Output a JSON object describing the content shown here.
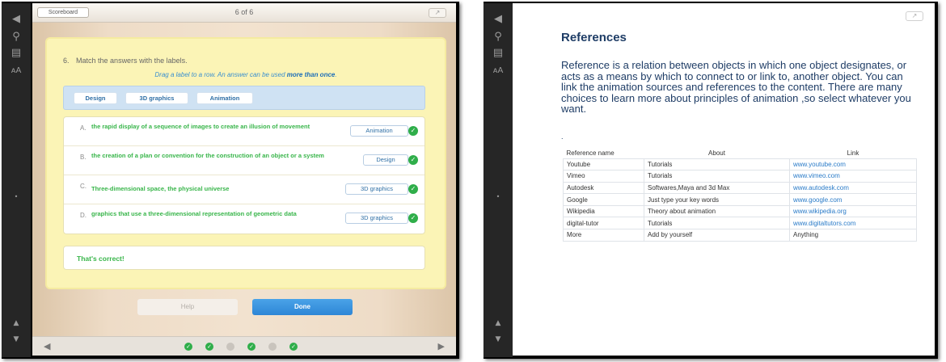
{
  "left_screen": {
    "toolbar": {
      "back_icon": "back-arrow-icon",
      "search_icon": "search-icon",
      "notes_icon": "notes-icon",
      "font_label": "ᴀA"
    },
    "top_bar": {
      "scoreboard_label": "Scoreboard",
      "page_indicator": "6 of 6"
    },
    "quiz": {
      "question_number": "6.",
      "question_text": "Match the answers with the labels.",
      "instruction_prefix": "Drag a label to a row. An answer can be used",
      "instruction_emphasis": "more than once",
      "instruction_suffix": ".",
      "labels": [
        "Design",
        "3D graphics",
        "Animation"
      ],
      "rows": [
        {
          "letter": "A.",
          "text": "the rapid display of a sequence of images to create an illusion of movement",
          "answer": "Animation",
          "correct": true
        },
        {
          "letter": "B.",
          "text": "the creation of a plan or convention for the construction of an object or a system",
          "answer": "Design",
          "correct": true
        },
        {
          "letter": "C.",
          "text": "Three-dimensional space, the physical universe",
          "answer": "3D graphics",
          "correct": true
        },
        {
          "letter": "D.",
          "text": "graphics that use a three-dimensional representation of geometric data",
          "answer": "3D graphics",
          "correct": true
        }
      ],
      "feedback": "That's correct!"
    },
    "buttons": {
      "help_label": "Help",
      "done_label": "Done"
    },
    "progress_dots": [
      "done",
      "done",
      "empty",
      "done",
      "empty",
      "done"
    ],
    "colors": {
      "correct_green": "#38b54a",
      "done_blue": "#2e86d6",
      "card_yellow": "#fbf4b6"
    }
  },
  "right_screen": {
    "title": "References",
    "body": "Reference is a relation between objects in which one object designates, or acts as a means by which to connect to or link to, another object. You can link the animation sources and references to the content. There are many choices to learn more about principles of animation ,so select whatever you want.",
    "stray_mark": ".",
    "table": {
      "headers": [
        "Reference name",
        "About",
        "Link"
      ],
      "rows": [
        [
          "Youtube",
          "Tutorials",
          "www.youtube.com"
        ],
        [
          "Vimeo",
          "Tutorials",
          "www.vimeo.com"
        ],
        [
          "Autodesk",
          "Softwares,Maya and 3d Max",
          "www.autodesk.com"
        ],
        [
          "Google",
          "Just type your key words",
          "www.google.com"
        ],
        [
          "Wikipedia",
          "Theory about animation",
          "www.wikipedia.org"
        ],
        [
          "digital-tutor",
          "Tutorials",
          "www.digitaltutors.com"
        ],
        [
          "More",
          "Add by yourself",
          "Anything"
        ]
      ]
    },
    "colors": {
      "title_navy": "#1f3d66",
      "link_blue": "#2a7bc8"
    }
  }
}
